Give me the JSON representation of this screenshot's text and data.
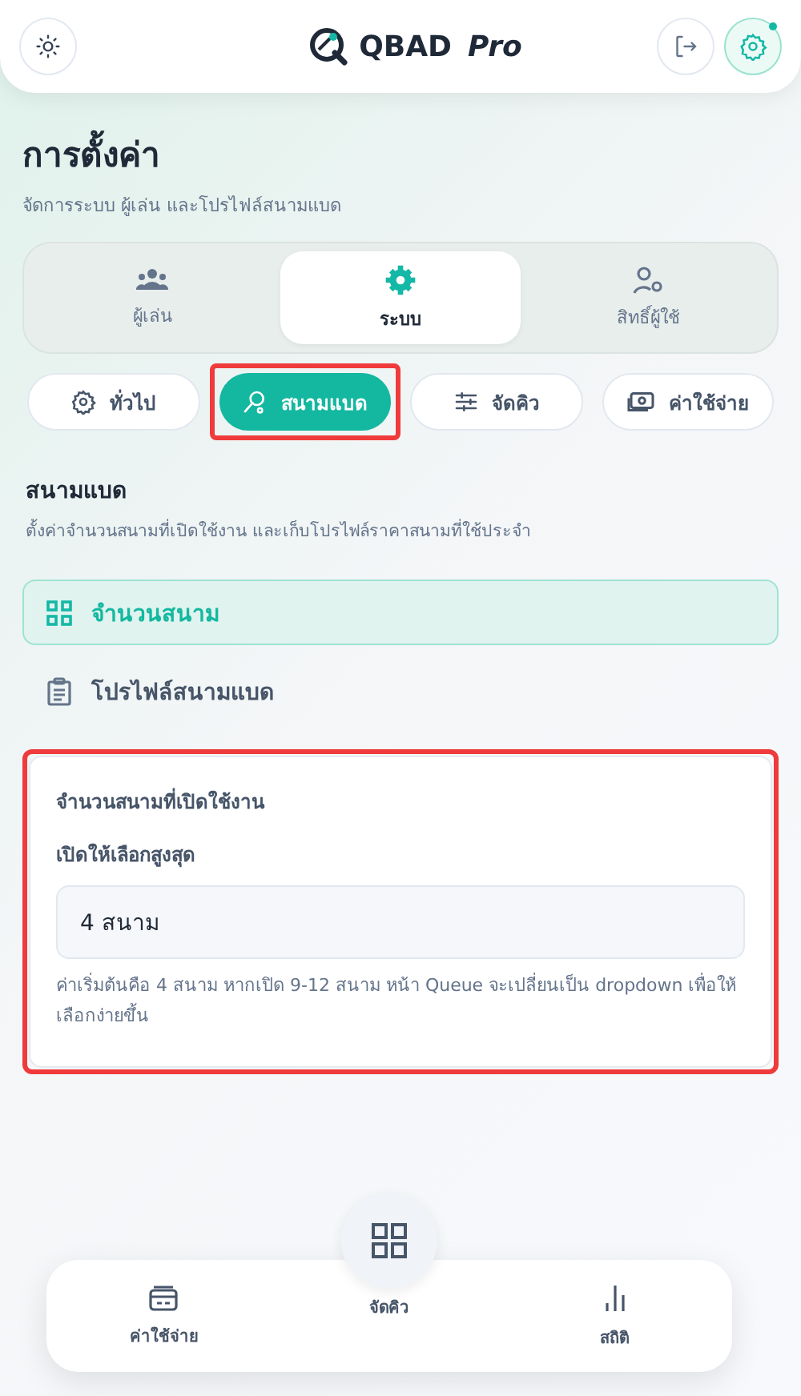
{
  "header": {
    "brand": "QBAD",
    "brand_suffix": "Pro",
    "settings_notification": true
  },
  "page": {
    "title": "การตั้งค่า",
    "subtitle": "จัดการระบบ ผู้เล่น และโปรไฟล์สนามแบด"
  },
  "tabs": [
    {
      "label": "ผู้เล่น",
      "kind": "users",
      "selected": false
    },
    {
      "label": "ระบบ",
      "kind": "gear",
      "selected": true
    },
    {
      "label": "สิทธิ์ผู้ใช้",
      "kind": "usergear",
      "selected": false
    }
  ],
  "chips": [
    {
      "label": "ทั่วไป",
      "kind": "gear",
      "selected": false,
      "highlighted": false
    },
    {
      "label": "สนามแบด",
      "kind": "racket",
      "selected": true,
      "highlighted": true
    },
    {
      "label": "จัดคิว",
      "kind": "sliders",
      "selected": false,
      "highlighted": false
    },
    {
      "label": "ค่าใช้จ่าย",
      "kind": "money",
      "selected": false,
      "highlighted": false
    }
  ],
  "section": {
    "title": "สนามแบด",
    "description": "ตั้งค่าจำนวนสนามที่เปิดใช้งาน และเก็บโปรไฟล์ราคาสนามที่ใช้ประจำ"
  },
  "sub_nav": [
    {
      "label": "จำนวนสนาม",
      "kind": "grid",
      "selected": true
    },
    {
      "label": "โปรไฟล์สนามแบด",
      "kind": "clipboard",
      "selected": false
    }
  ],
  "card": {
    "title": "จำนวนสนามที่เปิดใช้งาน",
    "field_label": "เปิดให้เลือกสูงสุด",
    "value": "4 สนาม",
    "hint": "ค่าเริ่มต้นคือ 4 สนาม หากเปิด 9-12 สนาม หน้า Queue จะเปลี่ยนเป็น dropdown เพื่อให้เลือกง่ายขึ้น",
    "highlighted": true
  },
  "bottom_nav": [
    {
      "label": "ค่าใช้จ่าย",
      "kind": "wallet"
    },
    {
      "label": "จัดคิว",
      "kind": "raised"
    },
    {
      "label": "สถิติ",
      "kind": "chart"
    }
  ]
}
